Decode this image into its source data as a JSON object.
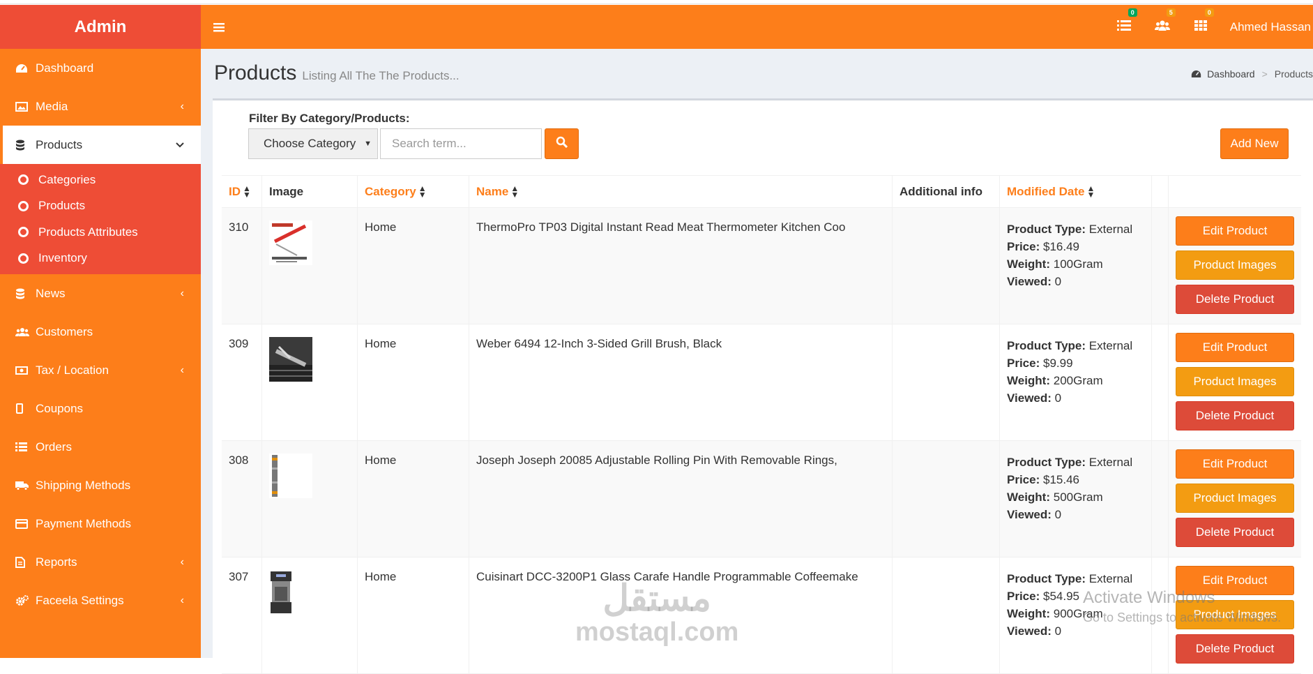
{
  "app": {
    "title": "Admin"
  },
  "sidebar": {
    "items": [
      {
        "label": "Dashboard"
      },
      {
        "label": "Media"
      },
      {
        "label": "Products"
      },
      {
        "label": "News"
      },
      {
        "label": "Customers"
      },
      {
        "label": "Tax / Location"
      },
      {
        "label": "Coupons"
      },
      {
        "label": "Orders"
      },
      {
        "label": "Shipping Methods"
      },
      {
        "label": "Payment Methods"
      },
      {
        "label": "Reports"
      },
      {
        "label": "Faceela Settings"
      }
    ],
    "submenu": [
      {
        "label": "Categories"
      },
      {
        "label": "Products"
      },
      {
        "label": "Products Attributes"
      },
      {
        "label": "Inventory"
      }
    ]
  },
  "header": {
    "badges": [
      "0",
      "5",
      "0"
    ],
    "badge_colors": [
      "#00a65a",
      "#f39c12",
      "#f39c12"
    ],
    "user_name": "Ahmed Hassan"
  },
  "page": {
    "title": "Products",
    "subtitle": "Listing All The The Products...",
    "breadcrumb": [
      "Dashboard",
      "Products"
    ]
  },
  "filter": {
    "label": "Filter By Category/Products:",
    "select_value": "Choose Category",
    "search_placeholder": "Search term...",
    "add_new_label": "Add New"
  },
  "table": {
    "headers": [
      "ID",
      "Image",
      "Category",
      "Name",
      "Additional info",
      "Modified Date"
    ],
    "info_labels": {
      "type": "Product Type:",
      "price": "Price:",
      "weight": "Weight:",
      "viewed": "Viewed:"
    },
    "actions": {
      "edit": "Edit Product",
      "images": "Product Images",
      "delete": "Delete Product"
    },
    "rows": [
      {
        "id": "310",
        "category": "Home",
        "name": "ThermoPro TP03 Digital Instant Read Meat Thermometer Kitchen Coo",
        "type": "External",
        "price": "$16.49",
        "weight": "100Gram",
        "viewed": "0"
      },
      {
        "id": "309",
        "category": "Home",
        "name": "Weber 6494 12-Inch 3-Sided Grill Brush, Black",
        "type": "External",
        "price": "$9.99",
        "weight": "200Gram",
        "viewed": "0"
      },
      {
        "id": "308",
        "category": "Home",
        "name": "Joseph Joseph 20085 Adjustable Rolling Pin With Removable Rings,",
        "type": "External",
        "price": "$15.46",
        "weight": "500Gram",
        "viewed": "0"
      },
      {
        "id": "307",
        "category": "Home",
        "name": "Cuisinart DCC-3200P1 Glass Carafe Handle Programmable Coffeemake",
        "type": "External",
        "price": "$54.95",
        "weight": "900Gram",
        "viewed": "0"
      }
    ]
  },
  "overlay": {
    "watermark_ar": "مستقل",
    "watermark_en": "mostaql.com",
    "activate_title": "Activate Windows",
    "activate_sub": "Go to Settings to activate Windows."
  },
  "colors": {
    "accent": "#fd7e1a",
    "logo_bg": "#ee4d36",
    "warning": "#f39c12",
    "danger": "#dd4b39"
  }
}
